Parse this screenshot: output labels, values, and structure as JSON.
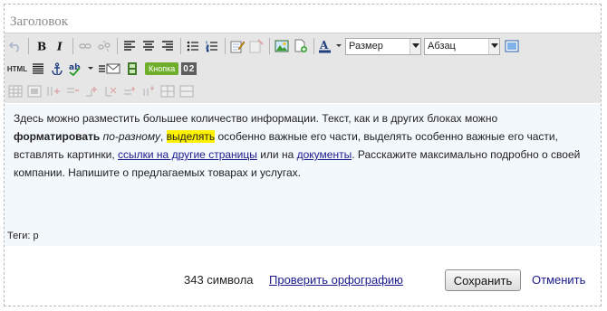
{
  "title_field": {
    "placeholder": "Заголовок",
    "value": ""
  },
  "toolbar": {
    "row1": {
      "size_select": "Размер",
      "format_select": "Абзац"
    },
    "row2": {
      "html_label": "HTML",
      "button_label": "Кнопка",
      "badge_label": "02"
    }
  },
  "content": {
    "p1": "Здесь можно разместить большее количество информации. Текст, как и в других блоках можно",
    "bold": "форматировать",
    "italic": "по-разному",
    "sep1": ", ",
    "highlight": "выделять",
    "p2": " особенно важные его части, выделять особенно важные его части, вставлять картинки, ",
    "link1": "ссылки на другие страницы",
    "p3": " или на ",
    "link2": "документы",
    "p4": ". Расскажите максимально подробно о своей компании. Напишите о предлагаемых товарах и услугах."
  },
  "tags": {
    "text": "Теги: p"
  },
  "footer": {
    "char_count": "343 символа",
    "spellcheck_link": "Проверить орфографию",
    "save_button": "Сохранить",
    "cancel_link": "Отменить"
  },
  "colors": {
    "toolbar_bg": "#e6e6e6",
    "content_bg": "#f3f8fd",
    "link": "#1a1a8c",
    "highlight": "#fff200",
    "button_green": "#6fae2b"
  }
}
